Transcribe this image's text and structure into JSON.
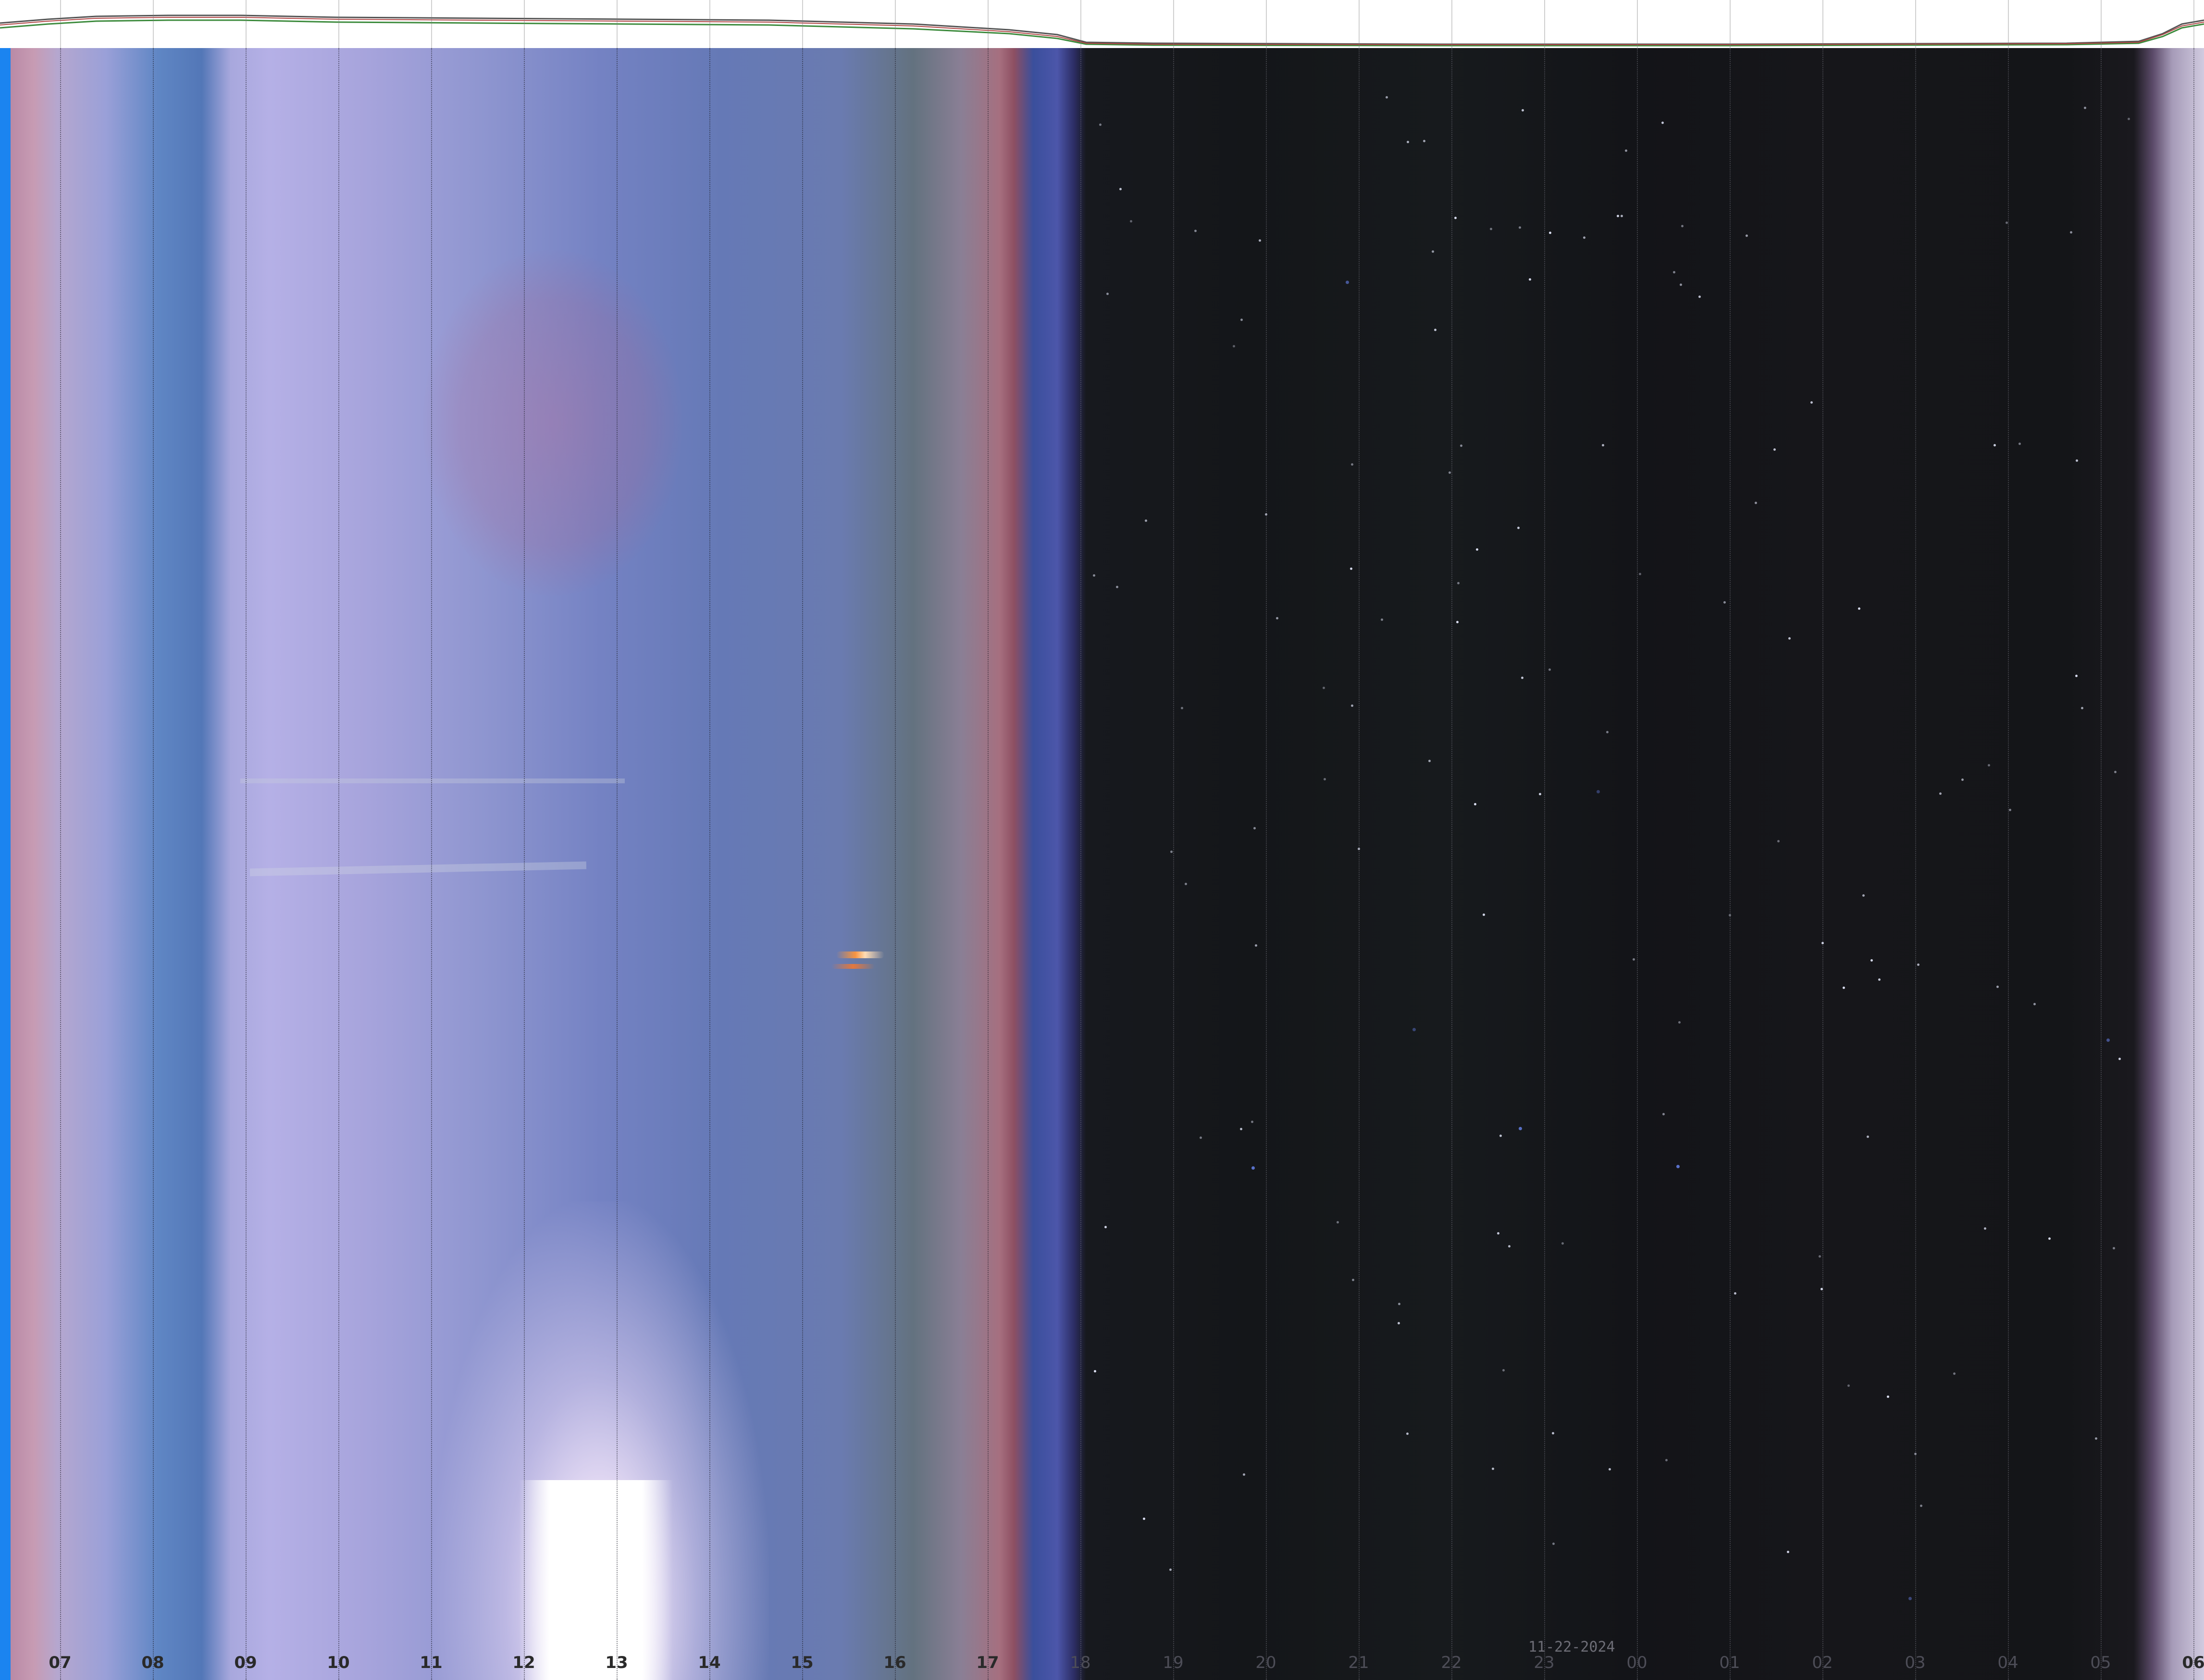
{
  "keogram": {
    "date": "11-22-2024",
    "hours": [
      "07",
      "08",
      "09",
      "10",
      "11",
      "12",
      "13",
      "14",
      "15",
      "16",
      "17",
      "18",
      "19",
      "20",
      "21",
      "22",
      "23",
      "00",
      "01",
      "02",
      "03",
      "04",
      "05",
      "06"
    ]
  },
  "colors": {
    "day_sky": "#5f86c4",
    "twilight_pink": "#a66f7f",
    "night_sky": "#141619",
    "graph_background": "#ffffff",
    "left_edge_blue": "#1b84f0"
  }
}
